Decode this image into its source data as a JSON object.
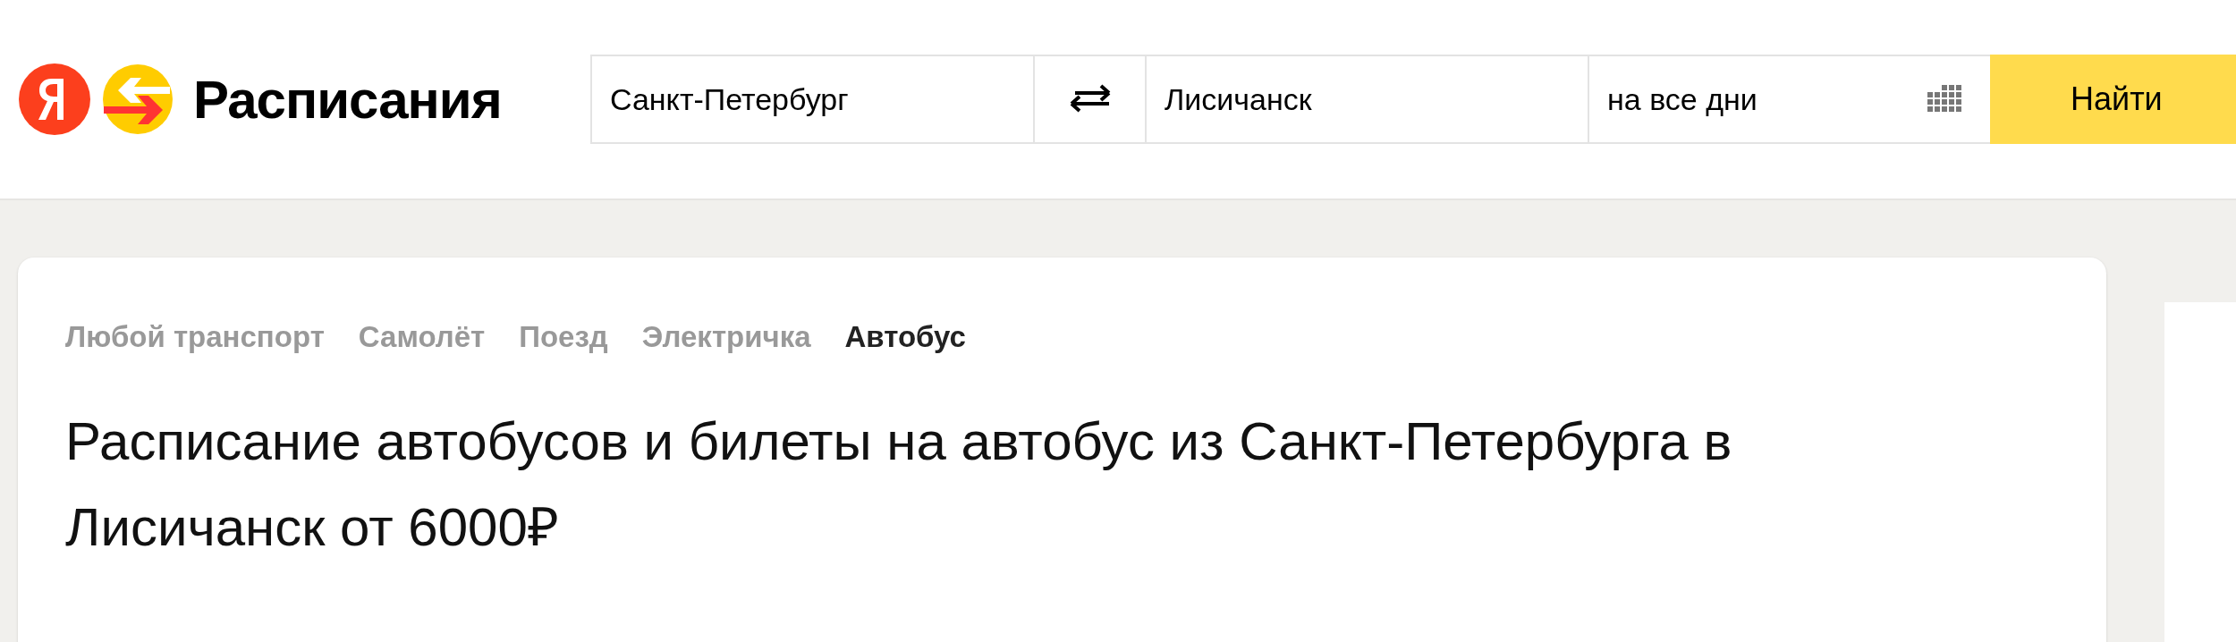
{
  "header": {
    "brand": "Расписания",
    "search": {
      "from": "Санкт-Петербург",
      "to": "Лисичанск",
      "date": "на все дни",
      "submit": "Найти"
    }
  },
  "transport_tabs": [
    {
      "label": "Любой транспорт",
      "selected": false
    },
    {
      "label": "Самолёт",
      "selected": false
    },
    {
      "label": "Поезд",
      "selected": false
    },
    {
      "label": "Электричка",
      "selected": false
    },
    {
      "label": "Автобус",
      "selected": true
    }
  ],
  "title": "Расписание автобусов и билеты на автобус из Санкт-Петербурга в Лисичанск от 6000₽"
}
